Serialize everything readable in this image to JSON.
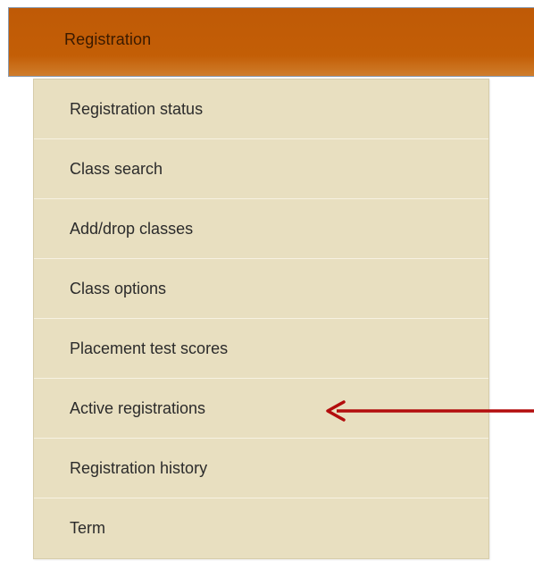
{
  "nav": {
    "header_label": "Registration",
    "items": [
      {
        "label": "Registration status"
      },
      {
        "label": "Class search"
      },
      {
        "label": "Add/drop classes"
      },
      {
        "label": "Class options"
      },
      {
        "label": "Placement test scores"
      },
      {
        "label": "Active registrations"
      },
      {
        "label": "Registration history"
      },
      {
        "label": "Term"
      }
    ]
  },
  "annotation": {
    "arrow_color": "#b30d0d",
    "arrow_icon": "arrow-left-icon",
    "points_to": "Active registrations"
  },
  "colors": {
    "header_bg": "#c05c06",
    "header_text": "#3a1a00",
    "submenu_bg": "#e8dfc0",
    "item_text": "#2b2b2b"
  }
}
